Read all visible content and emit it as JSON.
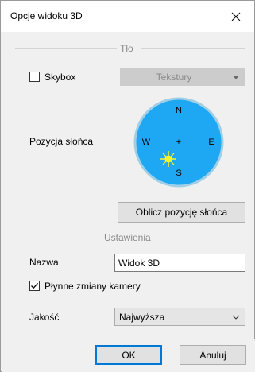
{
  "window": {
    "title": "Opcje widoku 3D"
  },
  "background_group": {
    "label": "Tło",
    "skybox": {
      "label": "Skybox",
      "checked": false
    },
    "textures_select": {
      "value": "Tekstury",
      "enabled": false
    },
    "sun_position_label": "Pozycja słońca",
    "compass": {
      "north": "N",
      "south": "S",
      "west": "W",
      "east": "E",
      "center": "+"
    },
    "calc_button_label": "Oblicz pozycję słońca"
  },
  "settings_group": {
    "label": "Ustawienia",
    "name_label": "Nazwa",
    "name_value": "Widok 3D",
    "smooth_camera": {
      "label": "Płynne zmiany kamery",
      "checked": true
    },
    "quality_label": "Jakość",
    "quality_value": "Najwyższa"
  },
  "footer": {
    "ok_label": "OK",
    "cancel_label": "Anuluj"
  },
  "colors": {
    "compass_fill": "#1ea7f2",
    "compass_border": "#a0cfe6",
    "sun_color": "#f5f52a",
    "accent": "#0078d7"
  }
}
